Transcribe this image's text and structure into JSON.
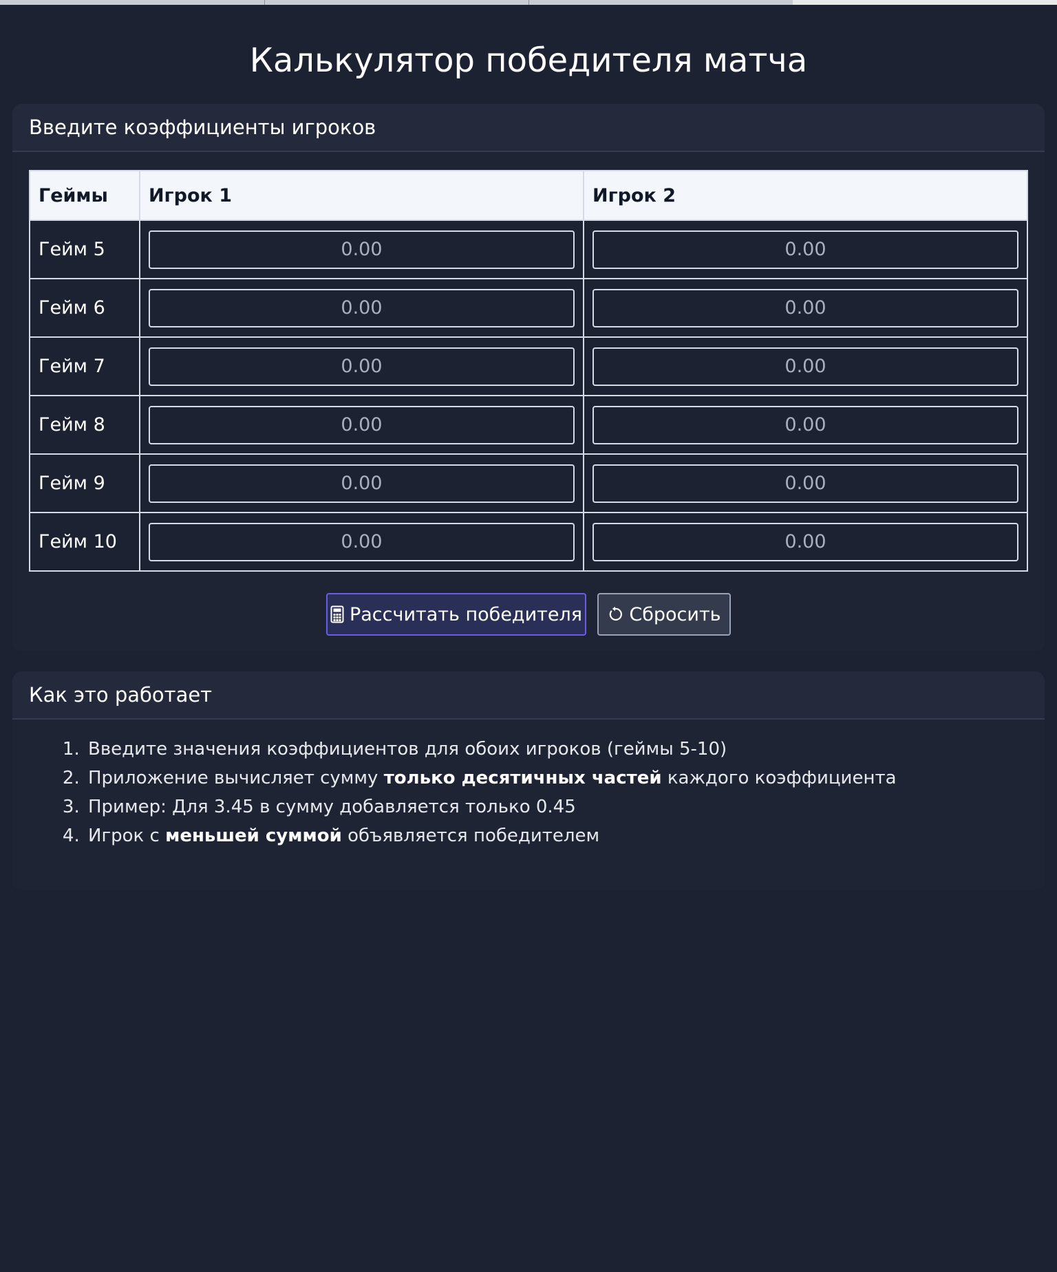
{
  "page": {
    "title": "Калькулятор победителя матча"
  },
  "odds_card": {
    "header": "Введите коэффициенты игроков",
    "columns": [
      "Геймы",
      "Игрок 1",
      "Игрок 2"
    ],
    "rows": [
      {
        "game": "Гейм 5",
        "player1": "",
        "player2": ""
      },
      {
        "game": "Гейм 6",
        "player1": "",
        "player2": ""
      },
      {
        "game": "Гейм 7",
        "player1": "",
        "player2": ""
      },
      {
        "game": "Гейм 8",
        "player1": "",
        "player2": ""
      },
      {
        "game": "Гейм 9",
        "player1": "",
        "player2": ""
      },
      {
        "game": "Гейм 10",
        "player1": "",
        "player2": ""
      }
    ],
    "input_placeholder": "0.00",
    "calculate_label": "Рассчитать победителя",
    "calculate_icon": "calculator-icon",
    "reset_label": "Сбросить",
    "reset_icon": "reset-icon"
  },
  "how_card": {
    "header": "Как это работает",
    "steps": [
      {
        "before": "Введите значения коэффициентов для обоих игроков (геймы 5-10)",
        "bold": "",
        "after": ""
      },
      {
        "before": "Приложение вычисляет сумму ",
        "bold": "только десятичных частей",
        "after": " каждого коэффициента"
      },
      {
        "before": "Пример: Для 3.45 в сумму добавляется только 0.45",
        "bold": "",
        "after": ""
      },
      {
        "before": "Игрок с ",
        "bold": "меньшей суммой",
        "after": " объявляется победителем"
      }
    ]
  },
  "colors": {
    "background": "#1d2233",
    "card": "#1f2434",
    "card_header": "#242a3b",
    "primary_border": "#6b5ce7",
    "table_header_bg": "#f3f6fa"
  }
}
